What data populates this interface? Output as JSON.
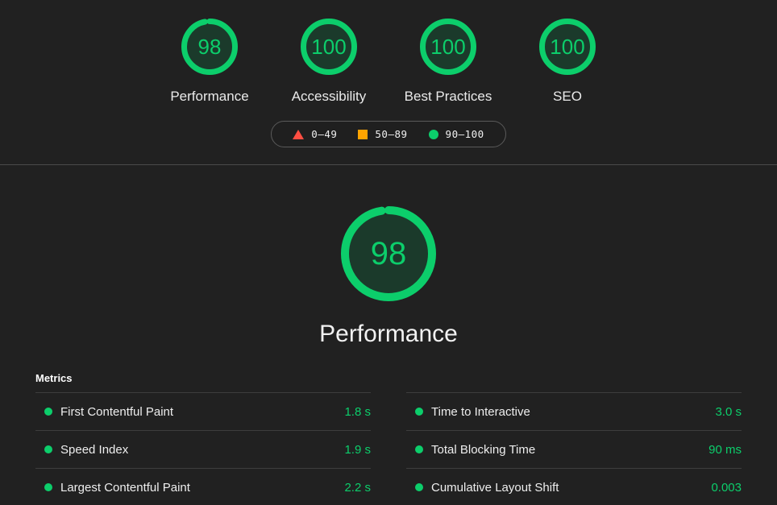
{
  "summary": {
    "gauges": [
      {
        "score": "98",
        "label": "Performance",
        "pct": 98,
        "rating": "pass"
      },
      {
        "score": "100",
        "label": "Accessibility",
        "pct": 100,
        "rating": "pass"
      },
      {
        "score": "100",
        "label": "Best Practices",
        "pct": 100,
        "rating": "pass"
      },
      {
        "score": "100",
        "label": "SEO",
        "pct": 100,
        "rating": "pass"
      }
    ],
    "legend": [
      {
        "shape": "triangle-icon",
        "label": "0–49",
        "color": "#ff4e42"
      },
      {
        "shape": "square-icon",
        "label": "50–89",
        "color": "#ffa400"
      },
      {
        "shape": "circle-icon",
        "label": "90–100",
        "color": "#0cce6b"
      }
    ]
  },
  "category": {
    "score": "98",
    "pct": 98,
    "label": "Performance"
  },
  "metrics": {
    "heading": "Metrics",
    "left": [
      {
        "title": "First Contentful Paint",
        "value": "1.8 s",
        "rating": "pass"
      },
      {
        "title": "Speed Index",
        "value": "1.9 s",
        "rating": "pass"
      },
      {
        "title": "Largest Contentful Paint",
        "value": "2.2 s",
        "rating": "pass"
      }
    ],
    "right": [
      {
        "title": "Time to Interactive",
        "value": "3.0 s",
        "rating": "pass"
      },
      {
        "title": "Total Blocking Time",
        "value": "90 ms",
        "rating": "pass"
      },
      {
        "title": "Cumulative Layout Shift",
        "value": "0.003",
        "rating": "pass"
      }
    ]
  },
  "colors": {
    "pass": "#0cce6b",
    "average": "#ffa400",
    "fail": "#ff4e42",
    "pass_fill": "#1b3a2b",
    "background": "#212121"
  }
}
